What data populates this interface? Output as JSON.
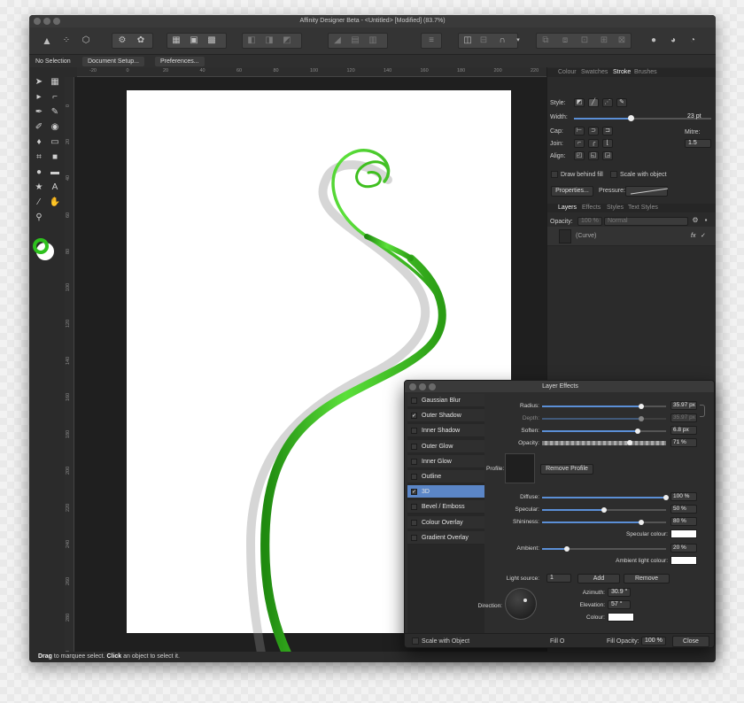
{
  "window": {
    "title": "Affinity Designer Beta - <Untitled> [Modified] (83.7%)"
  },
  "context_bar": {
    "selection": "No Selection",
    "document_setup": "Document Setup...",
    "preferences": "Preferences..."
  },
  "ruler_h": [
    "-20",
    "0",
    "20",
    "40",
    "60",
    "80",
    "100",
    "120",
    "140",
    "160",
    "180",
    "200",
    "220"
  ],
  "ruler_v": [
    "0",
    "20",
    "40",
    "60",
    "80",
    "100",
    "120",
    "140",
    "160",
    "180",
    "200",
    "220",
    "240",
    "260",
    "280",
    "300"
  ],
  "right_panel": {
    "tabs_top": [
      "Colour",
      "Swatches",
      "Stroke",
      "Brushes"
    ],
    "active_top": "Stroke",
    "style_label": "Style:",
    "width_label": "Width:",
    "width_value": "23 pt",
    "width_level": 0.55,
    "cap_label": "Cap:",
    "join_label": "Join:",
    "align_label": "Align:",
    "mitre_label": "Mitre:",
    "mitre_value": "1.5",
    "draw_behind_fill": "Draw behind fill",
    "scale_with_object": "Scale with object",
    "properties_btn": "Properties...",
    "pressure_label": "Pressure:",
    "tabs_layers": [
      "Layers",
      "Effects",
      "Styles",
      "Text Styles"
    ],
    "active_layers": "Layers",
    "opacity_label": "Opacity:",
    "opacity_value": "100 %",
    "blend_mode": "Normal",
    "layer_name": "(Curve)",
    "fx_badge": "fx"
  },
  "statusbar": {
    "drag": "Drag",
    "drag_text": " to marquee select. ",
    "click": "Click",
    "click_text": " an object to select it."
  },
  "dialog": {
    "title": "Layer Effects",
    "effects": [
      {
        "name": "Gaussian Blur",
        "checked": false,
        "selected": false
      },
      {
        "name": "Outer Shadow",
        "checked": true,
        "selected": false
      },
      {
        "name": "Inner Shadow",
        "checked": false,
        "selected": false
      },
      {
        "name": "Outer Glow",
        "checked": false,
        "selected": false
      },
      {
        "name": "Inner Glow",
        "checked": false,
        "selected": false
      },
      {
        "name": "Outline",
        "checked": false,
        "selected": false
      },
      {
        "name": "3D",
        "checked": true,
        "selected": true
      },
      {
        "name": "Bevel / Emboss",
        "checked": false,
        "selected": false
      },
      {
        "name": "Colour Overlay",
        "checked": false,
        "selected": false
      },
      {
        "name": "Gradient Overlay",
        "checked": false,
        "selected": false
      }
    ],
    "radius_label": "Radius:",
    "radius_value": "35.97 px",
    "radius_level": 0.8,
    "depth_label": "Depth:",
    "depth_value": "35.97 px",
    "depth_level": 0.8,
    "soften_label": "Soften:",
    "soften_value": "6.8 px",
    "soften_level": 0.77,
    "opacity_label": "Opacity:",
    "opacity_value": "71 %",
    "opacity_level": 0.71,
    "profile_label": "Profile:",
    "remove_profile": "Remove Profile",
    "diffuse_label": "Diffuse:",
    "diffuse_value": "100 %",
    "diffuse_level": 1.0,
    "specular_label": "Specular:",
    "specular_value": "50 %",
    "specular_level": 0.5,
    "shininess_label": "Shininess:",
    "shininess_value": "80 %",
    "shininess_level": 0.8,
    "specular_colour": "Specular colour:",
    "ambient_label": "Ambient:",
    "ambient_value": "20 %",
    "ambient_level": 0.2,
    "ambient_light_colour": "Ambient light colour:",
    "light_source_label": "Light source:",
    "light_source_value": "1",
    "add_btn": "Add",
    "remove_btn": "Remove",
    "direction_label": "Direction:",
    "azimuth_label": "Azimuth:",
    "azimuth_value": "30.9 °",
    "elevation_label": "Elevation:",
    "elevation_value": "57 °",
    "colour_label": "Colour:",
    "scale_with_object": "Scale with Object",
    "fill_label": "Fill O",
    "fill_opacity_label": "Fill Opacity:",
    "fill_opacity_value": "100 %",
    "close_btn": "Close"
  },
  "colors": {
    "accent": "#5b86c7",
    "curve_green": "#3fbf1f",
    "curve_dark": "#1e7d0c"
  }
}
